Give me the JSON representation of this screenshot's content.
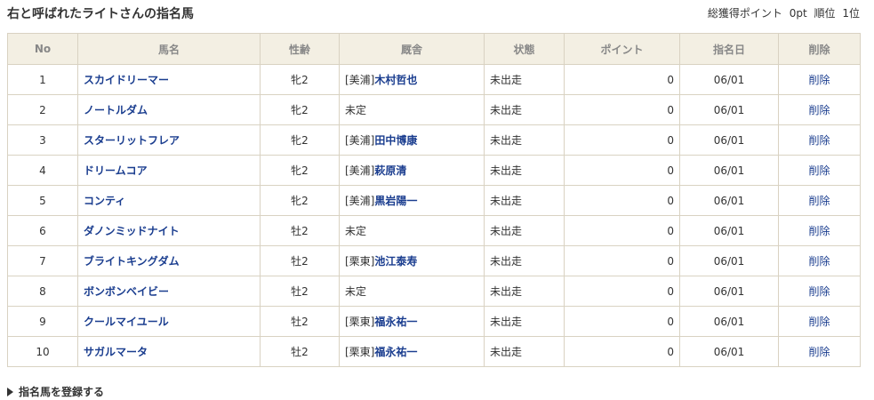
{
  "header": {
    "title": "右と呼ばれたライトさんの指名馬",
    "points_label": "総獲得ポイント",
    "points_value": "0pt",
    "rank_label": "順位",
    "rank_value": "1位"
  },
  "table": {
    "columns": [
      "No",
      "馬名",
      "性齢",
      "厩舎",
      "状態",
      "ポイント",
      "指名日",
      "削除"
    ],
    "rows": [
      {
        "no": "1",
        "name": "スカイドリーマー",
        "sex_age": "牝2",
        "stable_prefix": "[美浦]",
        "trainer": "木村哲也",
        "status": "未出走",
        "points": "0",
        "date": "06/01",
        "delete": "削除"
      },
      {
        "no": "2",
        "name": "ノートルダム",
        "sex_age": "牝2",
        "stable_prefix": "未定",
        "trainer": "",
        "status": "未出走",
        "points": "0",
        "date": "06/01",
        "delete": "削除"
      },
      {
        "no": "3",
        "name": "スターリットフレア",
        "sex_age": "牝2",
        "stable_prefix": "[美浦]",
        "trainer": "田中博康",
        "status": "未出走",
        "points": "0",
        "date": "06/01",
        "delete": "削除"
      },
      {
        "no": "4",
        "name": "ドリームコア",
        "sex_age": "牝2",
        "stable_prefix": "[美浦]",
        "trainer": "萩原清",
        "status": "未出走",
        "points": "0",
        "date": "06/01",
        "delete": "削除"
      },
      {
        "no": "5",
        "name": "コンティ",
        "sex_age": "牝2",
        "stable_prefix": "[美浦]",
        "trainer": "黒岩陽一",
        "status": "未出走",
        "points": "0",
        "date": "06/01",
        "delete": "削除"
      },
      {
        "no": "6",
        "name": "ダノンミッドナイト",
        "sex_age": "牡2",
        "stable_prefix": "未定",
        "trainer": "",
        "status": "未出走",
        "points": "0",
        "date": "06/01",
        "delete": "削除"
      },
      {
        "no": "7",
        "name": "ブライトキングダム",
        "sex_age": "牡2",
        "stable_prefix": "[栗東]",
        "trainer": "池江泰寿",
        "status": "未出走",
        "points": "0",
        "date": "06/01",
        "delete": "削除"
      },
      {
        "no": "8",
        "name": "ボンボンベイビー",
        "sex_age": "牡2",
        "stable_prefix": "未定",
        "trainer": "",
        "status": "未出走",
        "points": "0",
        "date": "06/01",
        "delete": "削除"
      },
      {
        "no": "9",
        "name": "クールマイユール",
        "sex_age": "牡2",
        "stable_prefix": "[栗東]",
        "trainer": "福永祐一",
        "status": "未出走",
        "points": "0",
        "date": "06/01",
        "delete": "削除"
      },
      {
        "no": "10",
        "name": "サガルマータ",
        "sex_age": "牡2",
        "stable_prefix": "[栗東]",
        "trainer": "福永祐一",
        "status": "未出走",
        "points": "0",
        "date": "06/01",
        "delete": "削除"
      }
    ]
  },
  "footer": {
    "register_link": "指名馬を登録する",
    "icon": "triangle-right-icon"
  },
  "colors": {
    "link": "#1a3d8f",
    "header_bg": "#f3efe3",
    "border": "#d9d2c2",
    "header_text": "#888888"
  }
}
